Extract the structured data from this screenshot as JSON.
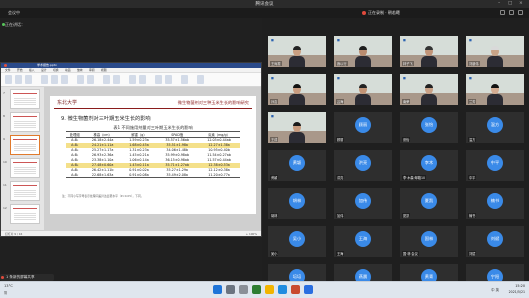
{
  "window": {
    "title": "腾讯会议"
  },
  "meeting": {
    "speaker_label": "正在讲话：",
    "top_left_label": "会议中",
    "recording_label": "正在录制 · 朝若曦"
  },
  "share": {
    "window_title": "学术报告.pptx",
    "menu": [
      "文件",
      "开始",
      "插入",
      "设计",
      "切换",
      "动画",
      "放映",
      "审阅",
      "视图"
    ],
    "thumb_numbers": [
      "7",
      "8",
      "9",
      "10",
      "11",
      "12"
    ],
    "status_left": "幻灯片 9 / 16",
    "status_right": "+ 100%"
  },
  "slide": {
    "logo_text": "东北大学",
    "header_title": "微生物菌剂对三种玉米生长的影响研究",
    "section_title": "9. 微生物菌剂对三叶期玉米生长的影响",
    "table_title": "表1 不同施用剂量对三叶期玉米生长的影响",
    "columns": [
      "处理组",
      "株高（cm）",
      "鲜重（g）",
      "SPAD值",
      "氮素（mg/g）"
    ],
    "rows": [
      [
        "A₁B₁",
        "26.18±2.44a",
        "1.59±0.23a",
        "35.57±1.56ab",
        "12.03±0.44ab"
      ],
      [
        "A₁B₂",
        "24.21±1.11a",
        "1.68±0.45a",
        "35.51±1.98a",
        "12.27±1.38a"
      ],
      [
        "A₁B₃",
        "25.27±1.17a",
        "1.31±0.23a",
        "34.06±1.48b",
        "10.95±0.40b"
      ],
      [
        "A₂B₁",
        "26.93±2.36a",
        "1.45±0.21a",
        "35.99±0.98ab",
        "11.54±0.27ab"
      ],
      [
        "A₂B₂",
        "23.38±1.10a",
        "1.06±0.14a",
        "36.15±0.98ab",
        "11.57±0.44ab"
      ],
      [
        "A₂B₃",
        "27.48±0.60a",
        "1.43±0.11a",
        "35.71±1.27ab",
        "12.38±0.53a"
      ],
      [
        "A₃B₁",
        "26.42±1.11b",
        "0.91±0.02a",
        "35.27±1.29a",
        "12.12±0.38a"
      ],
      [
        "A₃B₂",
        "22.68±1.63a",
        "0.91±0.08a",
        "35.49±2.08a",
        "11.20±0.77a"
      ]
    ],
    "note": "注：不同小写字母表示处理间差异达显著水平（P<0.05），下同。"
  },
  "participants": [
    {
      "name": "王尚振",
      "type": "video",
      "skin": "#c99f82",
      "hair": "#222"
    },
    {
      "name": "我以行",
      "type": "video",
      "skin": "#b98c70",
      "hair": "#1e1e1e"
    },
    {
      "name": "林子飞",
      "type": "video",
      "skin": "#c19478",
      "hair": "#333"
    },
    {
      "name": "刘朋伟",
      "type": "video",
      "skin": "#c8a488",
      "hair": "#d9d9d9"
    },
    {
      "name": "孙嘉",
      "type": "video",
      "skin": "#c89c80",
      "hair": "#111"
    },
    {
      "name": "吕海",
      "type": "video",
      "skin": "#c29375",
      "hair": "#222"
    },
    {
      "name": "南荣",
      "type": "video",
      "skin": "#c9a086",
      "hair": "#222"
    },
    {
      "name": "兰芳",
      "type": "video",
      "skin": "#d4ac92",
      "hair": "#111"
    },
    {
      "name": "王成",
      "type": "video",
      "skin": "#c79a7d",
      "hair": "#1a1a1a"
    },
    {
      "name": "顾丽",
      "type": "avatar",
      "avatar_text": "顾丽",
      "color": "#3a8ae8"
    },
    {
      "name": "张怡",
      "type": "avatar",
      "avatar_text": "张怡",
      "color": "#3a8ae8"
    },
    {
      "name": "温方",
      "type": "avatar",
      "avatar_text": "温方",
      "color": "#3a8ae8"
    },
    {
      "name": "黄颖",
      "type": "avatar",
      "avatar_text": "黄颖",
      "color": "#3a8ae8"
    },
    {
      "name": "洪亮",
      "type": "avatar",
      "avatar_text": "洪亮",
      "color": "#3a8ae8"
    },
    {
      "name": "李·木森·邮箱10",
      "type": "avatar",
      "avatar_text": "李木",
      "color": "#3a8ae8"
    },
    {
      "name": "中平",
      "type": "avatar",
      "avatar_text": "中平",
      "color": "#3a8ae8"
    },
    {
      "name": "胡林",
      "type": "avatar",
      "avatar_text": "胡林",
      "color": "#3a8ae8"
    },
    {
      "name": "加伟",
      "type": "avatar",
      "avatar_text": "加伟",
      "color": "#3a8ae8"
    },
    {
      "name": "夏凯",
      "type": "avatar",
      "avatar_text": "夏凯",
      "color": "#3a8ae8"
    },
    {
      "name": "楠书",
      "type": "avatar",
      "avatar_text": "楠书",
      "color": "#3a8ae8"
    },
    {
      "name": "吴小",
      "type": "avatar",
      "avatar_text": "吴小",
      "color": "#3a8ae8"
    },
    {
      "name": "王海",
      "type": "avatar",
      "avatar_text": "王海",
      "color": "#3a8ae8"
    },
    {
      "name": "国·林·会议",
      "type": "avatar",
      "avatar_text": "国林",
      "color": "#3a8ae8"
    },
    {
      "name": "刘斌",
      "type": "avatar",
      "avatar_text": "刘斌",
      "color": "#3a8ae8"
    },
    {
      "name": "培培",
      "type": "avatar",
      "avatar_text": "培培",
      "color": "#3a8ae8"
    },
    {
      "name": "燕晨",
      "type": "avatar",
      "avatar_text": "燕晨",
      "color": "#3a8ae8"
    },
    {
      "name": "黄青",
      "type": "avatar",
      "avatar_text": "黄青",
      "color": "#3a8ae8"
    },
    {
      "name": "宁阳",
      "type": "avatar",
      "avatar_text": "宁阳",
      "color": "#3a8ae8"
    }
  ],
  "notice": {
    "text": "1 条新的屏幕共享"
  },
  "taskbar": {
    "weather_temp": "13°C",
    "weather_desc": "阴",
    "time": "15:20",
    "date": "2021/5/21",
    "tray_text": "中 英"
  },
  "colors": {
    "accent": "#3a8ae8",
    "highlight": "#f4e08a",
    "slide_title": "#8a1c1c"
  }
}
